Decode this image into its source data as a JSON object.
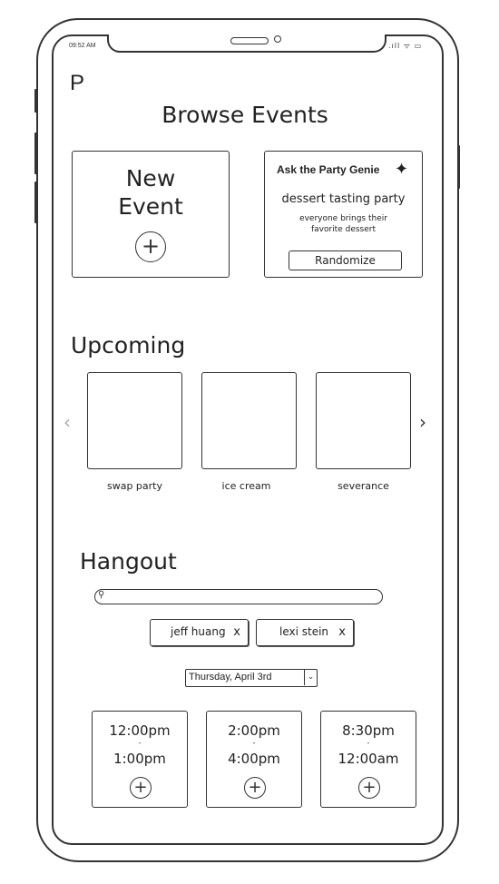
{
  "status_bar": {
    "time": "09:52 AM",
    "icons": ".ıll ᯤ ▭"
  },
  "app": {
    "logo": "P",
    "title": "Browse Events"
  },
  "new_event": {
    "label_line1": "New",
    "label_line2": "Event",
    "plus": "+"
  },
  "genie": {
    "title": "Ask the Party Genie",
    "sparkle": "✦",
    "idea": "dessert tasting party",
    "description": "everyone brings their favorite dessert",
    "randomize_label": "Randomize"
  },
  "upcoming": {
    "title": "Upcoming",
    "prev_arrow": "‹",
    "next_arrow": "›",
    "events": [
      {
        "caption": "swap party"
      },
      {
        "caption": "ice cream"
      },
      {
        "caption": "severance"
      }
    ]
  },
  "hangout": {
    "title": "Hangout",
    "search_placeholder": "",
    "search_icon": "⚲",
    "chips": [
      {
        "label": "jeff huang",
        "close": "x"
      },
      {
        "label": "lexi stein",
        "close": "x"
      }
    ],
    "date": {
      "selected": "Thursday, April 3rd",
      "chevron": "⌄"
    },
    "slots": [
      {
        "start": "12:00pm",
        "dash": "-",
        "end": "1:00pm",
        "plus": "+"
      },
      {
        "start": "2:00pm",
        "dash": "-",
        "end": "4:00pm",
        "plus": "+"
      },
      {
        "start": "8:30pm",
        "dash": "-",
        "end": "12:00am",
        "plus": "+"
      }
    ]
  }
}
